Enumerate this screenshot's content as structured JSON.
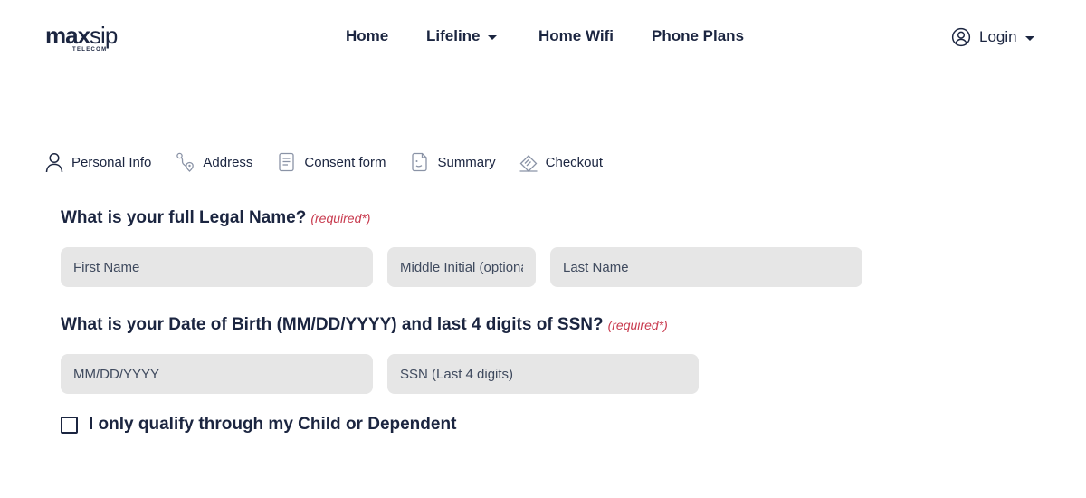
{
  "header": {
    "logo": {
      "bold": "max",
      "light": "sip",
      "subtitle": "TELECOM"
    },
    "nav": [
      {
        "label": "Home"
      },
      {
        "label": "Lifeline"
      },
      {
        "label": "Home Wifi"
      },
      {
        "label": "Phone Plans"
      }
    ],
    "login_label": "Login"
  },
  "steps": [
    {
      "label": "Personal Info",
      "icon": "person-icon"
    },
    {
      "label": "Address",
      "icon": "route-pin-icon"
    },
    {
      "label": "Consent form",
      "icon": "document-icon"
    },
    {
      "label": "Summary",
      "icon": "summary-document-icon"
    },
    {
      "label": "Checkout",
      "icon": "ticket-icon"
    }
  ],
  "form": {
    "name_question": "What is your full Legal Name?",
    "required_label": "(required*)",
    "first_name_placeholder": "First Name",
    "middle_initial_placeholder": "Middle Initial (optional)",
    "last_name_placeholder": "Last Name",
    "dob_question": "What is your Date of Birth (MM/DD/YYYY) and last 4 digits of SSN?",
    "dob_placeholder": "MM/DD/YYYY",
    "ssn_placeholder": "SSN (Last 4 digits)",
    "dependent_checkbox_label": "I only qualify through my Child or Dependent",
    "dependent_checked": false
  },
  "colors": {
    "text": "#1b2540",
    "field_background": "#e6e6e6",
    "required": "#c83a4e"
  }
}
